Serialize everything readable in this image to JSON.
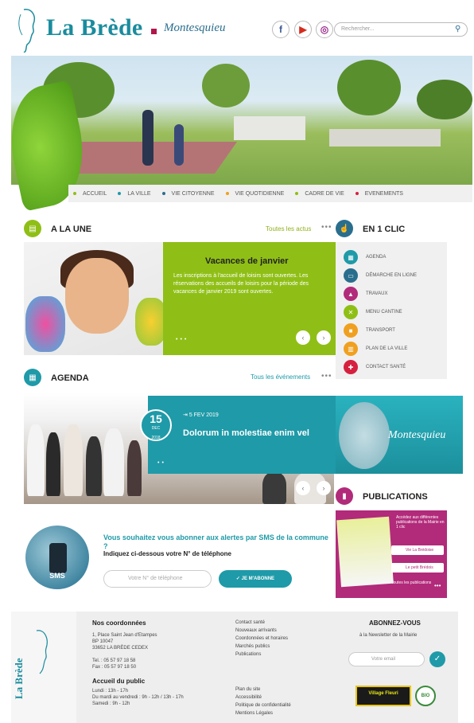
{
  "header": {
    "brand": "La Brède",
    "signature": "Montesquieu",
    "search_placeholder": "Rechercher...",
    "social": [
      {
        "name": "facebook",
        "glyph": "f",
        "color": "#3b5998"
      },
      {
        "name": "youtube",
        "glyph": "▶",
        "color": "#d52b1e"
      },
      {
        "name": "instagram",
        "glyph": "◎",
        "color": "#9b2f8e"
      }
    ]
  },
  "nav": {
    "items": [
      {
        "label": "ACCUEIL",
        "color": "#8fbf16"
      },
      {
        "label": "LA VILLE",
        "color": "#1f9aa8"
      },
      {
        "label": "VIE CITOYENNE",
        "color": "#2a6e8e"
      },
      {
        "label": "VIE QUOTIDIENNE",
        "color": "#f0a020"
      },
      {
        "label": "CADRE DE VIE",
        "color": "#8fbf16"
      },
      {
        "label": "EVENEMENTS",
        "color": "#d62040"
      }
    ]
  },
  "une": {
    "title": "A LA UNE",
    "link": "Toutes les actus",
    "headline": "Vacances de janvier",
    "text": "Les inscriptions à l'accueil de loisirs sont ouvertes. Les réservations des accueils de loisirs pour la période des vacances de janvier 2019 sont ouvertes."
  },
  "agenda": {
    "title": "AGENDA",
    "link": "Tous les événements",
    "day": "15",
    "month": "DEC",
    "year": "2018",
    "date_label": "5 FEV 2019",
    "event_title": "Dolorum in molestiae enim vel"
  },
  "clic": {
    "title": "EN 1 CLIC",
    "items": [
      {
        "label": "AGENDA",
        "color": "#1f9aa8",
        "icon": "calendar-icon",
        "glyph": "▦"
      },
      {
        "label": "DÉMARCHE EN LIGNE",
        "color": "#2a6e8e",
        "icon": "screen-icon",
        "glyph": "▭"
      },
      {
        "label": "TRAVAUX",
        "color": "#b22a7a",
        "icon": "warning-icon",
        "glyph": "▲"
      },
      {
        "label": "MENU CANTINE",
        "color": "#8fbf16",
        "icon": "fork-icon",
        "glyph": "✕"
      },
      {
        "label": "TRANSPORT",
        "color": "#f0a020",
        "icon": "bus-icon",
        "glyph": "■"
      },
      {
        "label": "PLAN DE LA VILLE",
        "color": "#f0a020",
        "icon": "map-icon",
        "glyph": "▥"
      },
      {
        "label": "CONTACT SANTÉ",
        "color": "#d62040",
        "icon": "health-icon",
        "glyph": "✚"
      }
    ]
  },
  "publications": {
    "title": "PUBLICATIONS",
    "text": "Accédez aux différentes publications de la Mairie en 1 clic",
    "btn1": "Vie La Brédoise",
    "btn2": "Le petit Brédois",
    "all": "Toutes les publications"
  },
  "sms": {
    "label": "SMS",
    "heading": "Vous souhaitez vous abonner aux alertes par SMS de la commune ?",
    "sub": "Indiquez ci-dessous votre N° de téléphone",
    "placeholder": "Votre N° de téléphone",
    "button": "JE M'ABONNE"
  },
  "footer": {
    "side_text": "La Brède",
    "coords_title": "Nos coordonnées",
    "address": [
      "1, Place Saint Jean d'Etampes",
      "BP 10047",
      "33652 LA BRÈDE CEDEX"
    ],
    "tel": "Tel. : 05 57 97 18 58",
    "fax": "Fax : 05 57 97 18 50",
    "public_title": "Accueil du public",
    "hours": [
      "Lundi : 13h - 17h",
      "Du mardi au vendredi : 9h - 12h / 13h - 17h",
      "Samedi : 9h - 12h"
    ],
    "links1": [
      "Contact santé",
      "Nouveaux arrivants",
      "Coordonnées et horaires",
      "Marchés publics",
      "Publications"
    ],
    "links2": [
      "Plan du site",
      "Accessibilité",
      "Politique de confidentialité",
      "Mentions Légales"
    ],
    "newsletter_title": "ABONNEZ-VOUS",
    "newsletter_sub": "à la Newsletter de la Mairie",
    "email_placeholder": "Votre email",
    "village": "Village Fleuri",
    "bio": "BIO"
  }
}
